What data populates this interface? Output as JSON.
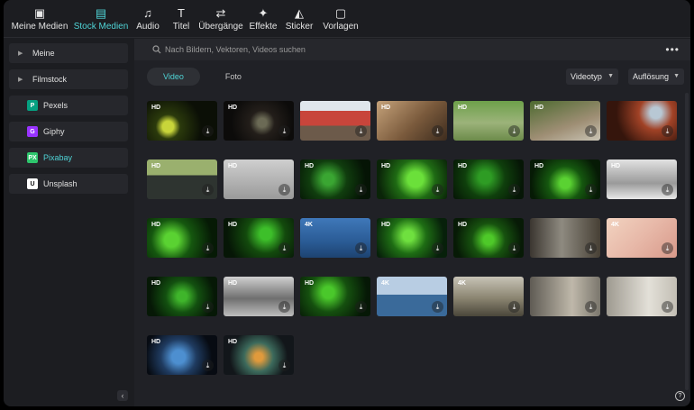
{
  "toolbar": {
    "items": [
      {
        "label": "Meine Medien",
        "icon": "media-icon"
      },
      {
        "label": "Stock Medien",
        "icon": "stock-media-icon",
        "active": true
      },
      {
        "label": "Audio",
        "icon": "music-icon"
      },
      {
        "label": "Titel",
        "icon": "title-icon"
      },
      {
        "label": "Übergänge",
        "icon": "transitions-icon"
      },
      {
        "label": "Effekte",
        "icon": "effects-icon"
      },
      {
        "label": "Sticker",
        "icon": "sticker-icon"
      },
      {
        "label": "Vorlagen",
        "icon": "templates-icon"
      }
    ]
  },
  "sidebar": {
    "items": [
      {
        "label": "Meine",
        "type": "group"
      },
      {
        "label": "Filmstock",
        "type": "group"
      },
      {
        "label": "Pexels",
        "type": "source",
        "logo": "P",
        "color": "#05a081"
      },
      {
        "label": "Giphy",
        "type": "source",
        "logo": "G",
        "color": "#9933ff"
      },
      {
        "label": "Pixabay",
        "type": "source",
        "logo": "PX",
        "color": "#2ec66d",
        "selected": true
      },
      {
        "label": "Unsplash",
        "type": "source",
        "logo": "U",
        "color": "#ffffff"
      }
    ]
  },
  "search": {
    "placeholder": "Nach Bildern, Vektoren, Videos suchen"
  },
  "tabs": [
    {
      "label": "Video",
      "active": true
    },
    {
      "label": "Foto"
    }
  ],
  "filters": {
    "videotyp": "Videotyp",
    "aufloesung": "Auflösung"
  },
  "thumbnails": [
    {
      "q": "HD",
      "bg": "radial-gradient(circle at 30% 65%, #c8d53a 0 10%, #2b3a0c 22%, #0b0f06 60%)"
    },
    {
      "q": "HD",
      "bg": "radial-gradient(circle at 55% 55%, #6b6a55 0 10%, #231e1a 28%, #0c0b0a 70%)"
    },
    {
      "q": "",
      "bg": "linear-gradient(180deg, #dfe6ec 0 25%, #c8453b 25% 62%, #6c5a4a 62%)"
    },
    {
      "q": "HD",
      "bg": "linear-gradient(135deg, #c5a27a 0%, #7a5a3c 55%, #3d2c1e 100%)"
    },
    {
      "q": "HD",
      "bg": "linear-gradient(180deg, #6da04a 0%, #9cb37a 55%, #6c8b4a 100%)"
    },
    {
      "q": "HD",
      "bg": "linear-gradient(160deg, #4d6a30 0%, #9e8e74 60%, #c9c4b5 100%)"
    },
    {
      "q": "",
      "bg": "radial-gradient(circle at 70% 30%, #b8c8d4 0 10%, #a14226 30%, #35150c 70%)"
    },
    {
      "q": "HD",
      "bg": "linear-gradient(180deg, #9ab06e 0 40%, #2e3430 40% 100%)"
    },
    {
      "q": "HD",
      "bg": "linear-gradient(180deg, #cfcfcf 0%, #9a9a9a 100%)"
    },
    {
      "q": "HD",
      "bg": "radial-gradient(circle at 40% 50%, #3aa632 0 12%, #103d0e 40%, #051405 80%)"
    },
    {
      "q": "HD",
      "bg": "radial-gradient(circle at 55% 50%, #6be03a 0 18%, #1f6a14 45%, #0a2408 85%)"
    },
    {
      "q": "HD",
      "bg": "radial-gradient(circle at 45% 45%, #2e9c24 0 14%, #0f3f0c 45%, #061606 85%)"
    },
    {
      "q": "HD",
      "bg": "radial-gradient(circle at 50% 60%, #5ad232 0 12%, #15570f 40%, #061a05 80%)"
    },
    {
      "q": "HD",
      "bg": "linear-gradient(180deg, #e2e2e2 0%, #9a9a9a 60%, #e8e8e8 100%)"
    },
    {
      "q": "HD",
      "bg": "radial-gradient(circle at 35% 55%, #5ad232 0 14%, #15570f 40%, #061a05 80%)"
    },
    {
      "q": "HD",
      "bg": "radial-gradient(circle at 60% 40%, #3dbf2a 0 12%, #134a0d 40%, #061606 80%)"
    },
    {
      "q": "4K",
      "bg": "linear-gradient(180deg, #3f78b9 0%, #2a5b95 60%, #1d4370 100%)"
    },
    {
      "q": "HD",
      "bg": "radial-gradient(circle at 45% 45%, #6fe03f 0 12%, #1e6d14 40%, #07200a 80%)"
    },
    {
      "q": "HD",
      "bg": "radial-gradient(circle at 50% 55%, #4ec929 0 12%, #17520f 40%, #071a06 80%)"
    },
    {
      "q": "",
      "bg": "linear-gradient(90deg, #3b3630 0%, #8e8a80 45%, #474035 100%)"
    },
    {
      "q": "4K",
      "bg": "linear-gradient(135deg, #f2d3c0 0%, #e7b8a8 50%, #d8998a 100%)"
    },
    {
      "q": "HD",
      "bg": "radial-gradient(circle at 50% 50%, #3fb52b 0 12%, #135010 40%, #061806 80%)"
    },
    {
      "q": "HD",
      "bg": "linear-gradient(180deg, #d0d0d0 0%, #6f6f6f 55%, #bdbdbd 100%)"
    },
    {
      "q": "HD",
      "bg": "radial-gradient(circle at 40% 40%, #4ac82b 0 12%, #15500f 40%, #061806 80%)"
    },
    {
      "q": "4K",
      "bg": "linear-gradient(180deg, #b8cde3 0 45%, #3a6a9a 45% 100%)"
    },
    {
      "q": "4K",
      "bg": "linear-gradient(180deg, #c7c3b6 0%, #8a8470 55%, #4a463a 100%)"
    },
    {
      "q": "",
      "bg": "linear-gradient(90deg, #5f5b54 0%, #bfb8aa 60%, #7b776d 100%)"
    },
    {
      "q": "",
      "bg": "linear-gradient(90deg, #9e9a90 0%, #e3e0d8 60%, #c2beb4 100%)"
    },
    {
      "q": "HD",
      "bg": "radial-gradient(circle at 45% 55%, #4d8fd0 0 15%, #1f3b60 40%, #070b12 75%)"
    },
    {
      "q": "HD",
      "bg": "radial-gradient(circle at 50% 55%, #e09a3c 0 10%, #3c6a5c 35%, #12161a 70%)"
    }
  ],
  "help": "?"
}
